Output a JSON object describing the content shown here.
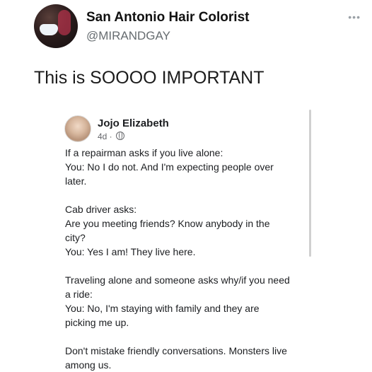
{
  "tweet": {
    "display_name": "San Antonio Hair Colorist",
    "username": "@MIRANDGAY",
    "more_menu": "•••",
    "text": "This is SOOOO IMPORTANT"
  },
  "embedded_post": {
    "author": "Jojo Elizabeth",
    "time": "4d ·",
    "privacy_icon": "globe-icon",
    "paragraphs": [
      {
        "line1": "If a repairman asks if you live alone:",
        "line2": "You: No I do not. And I'm expecting people over",
        "line3": "later."
      },
      {
        "line1": "Cab driver asks:",
        "line2": "Are you meeting friends? Know anybody in the",
        "line3": "city?",
        "line4": "You: Yes I am! They live here."
      },
      {
        "line1": "Traveling alone and someone asks why/if you need",
        "line2": "a ride:",
        "line3": "You: No, I'm staying with family and they are",
        "line4": "picking me up."
      },
      {
        "line1": "Don't mistake friendly conversations. Monsters live",
        "line2": "among us."
      }
    ]
  }
}
